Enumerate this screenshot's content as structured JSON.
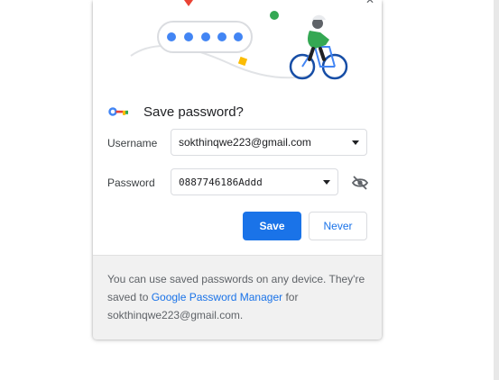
{
  "dialog": {
    "title": "Save password?",
    "username_label": "Username",
    "username_value": "sokthinqwe223@gmail.com",
    "password_label": "Password",
    "password_value": "0887746186Addd",
    "save_label": "Save",
    "never_label": "Never",
    "footer_text_before": "You can use saved passwords on any device. They're saved to ",
    "footer_link": "Google Password Manager",
    "footer_text_after": " for sokthinqwe223@gmail.com."
  },
  "icons": {
    "key": "key-icon",
    "eye": "eye-off-icon",
    "caret": "chevron-down-icon",
    "close": "close-icon"
  },
  "colors": {
    "accent": "#1a73e8",
    "footer_bg": "#f1f1f1"
  }
}
